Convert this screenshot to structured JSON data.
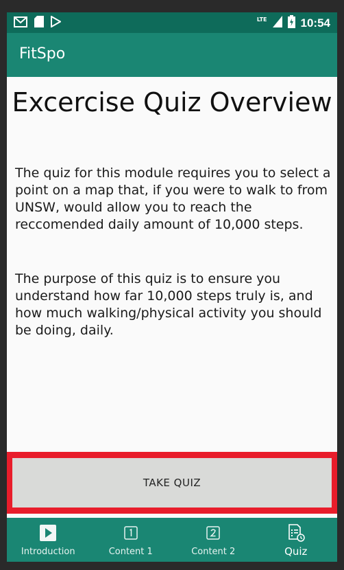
{
  "status_bar": {
    "time": "10:54",
    "network": "LTE",
    "left_icons": [
      "gmail-icon",
      "sd-card-icon",
      "play-store-icon"
    ],
    "right_icons": [
      "signal-icon",
      "battery-charging-icon"
    ]
  },
  "app_bar": {
    "title": "FitSpo"
  },
  "main": {
    "heading": "Excercise Quiz Overview",
    "paragraph_1": "The quiz for this module requires you to select a point on a map that, if you were to walk to from UNSW, would allow you to reach the reccomended daily amount of 10,000 steps.",
    "paragraph_2": "The purpose of this quiz is to ensure you understand how far 10,000 steps truly is, and how much walking/physical activity you should be doing, daily."
  },
  "action": {
    "take_quiz_label": "TAKE QUIZ"
  },
  "bottom_nav": {
    "items": [
      {
        "label": "Introduction",
        "icon": "play-icon",
        "active": false
      },
      {
        "label": "Content 1",
        "icon": "number-one-icon",
        "active": false
      },
      {
        "label": "Content 2",
        "icon": "number-two-icon",
        "active": false
      },
      {
        "label": "Quiz",
        "icon": "quiz-icon",
        "active": true
      }
    ]
  },
  "colors": {
    "status_bar": "#0e6b5a",
    "primary": "#1a8673",
    "highlight": "#e81d2b",
    "button": "#d9dad8",
    "background": "#fafafa"
  }
}
